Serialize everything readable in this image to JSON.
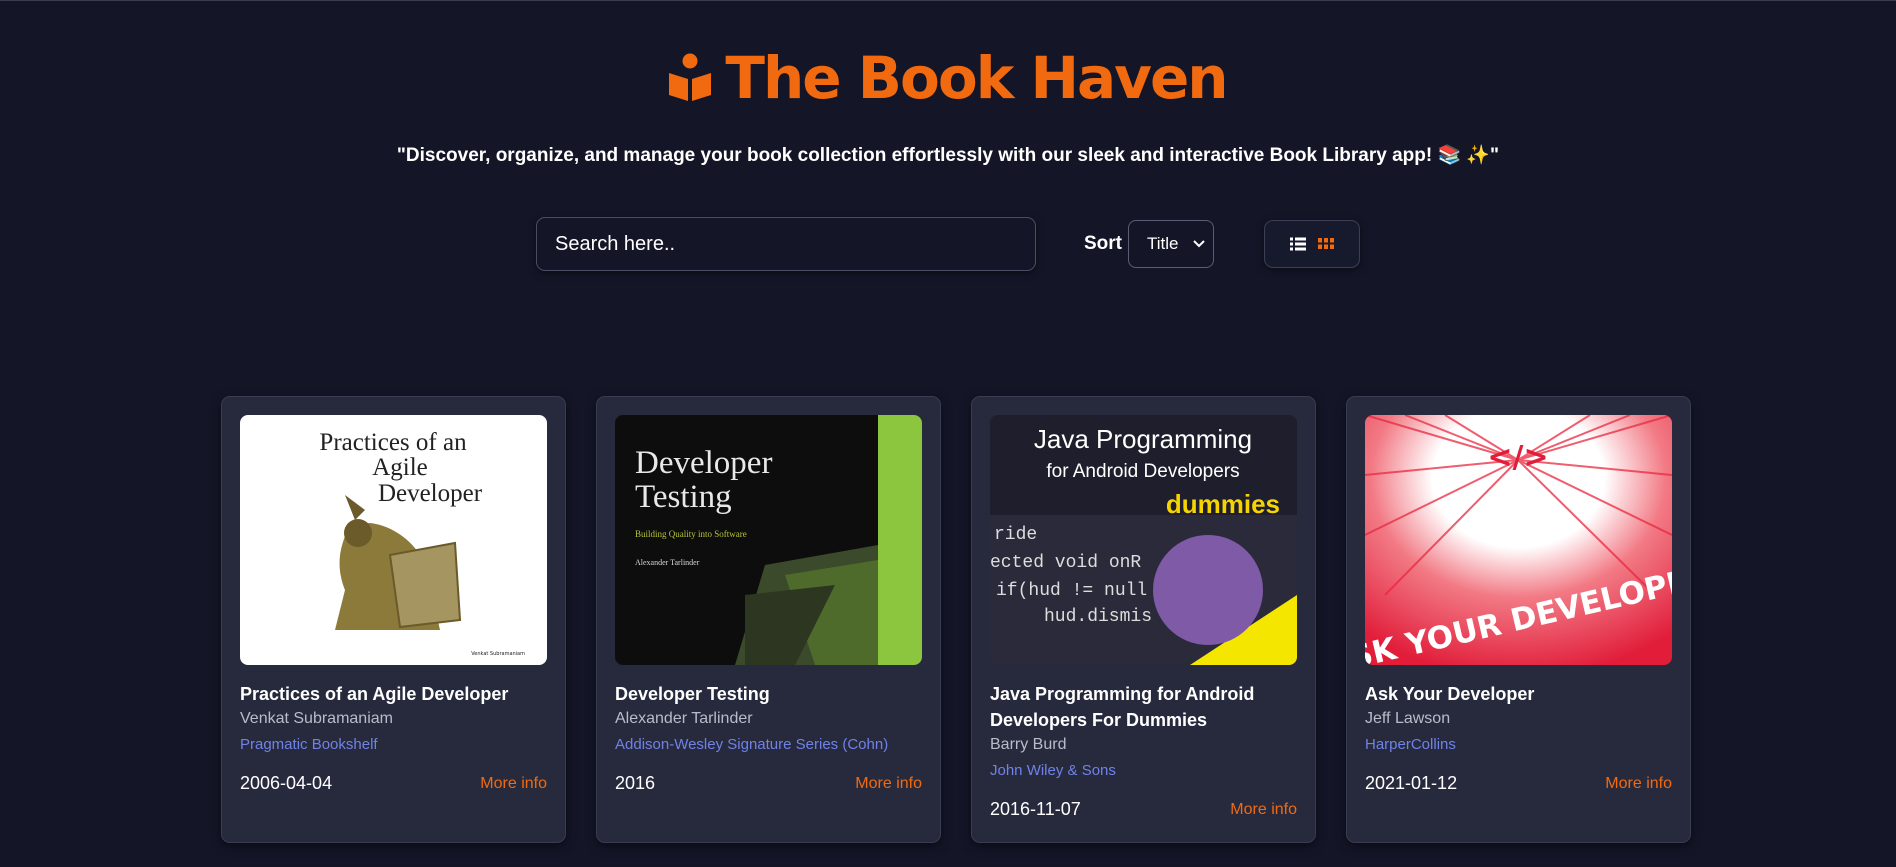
{
  "header": {
    "logo_icon": "reading-person-icon",
    "title": "The Book Haven",
    "accent_color": "#f26a0f"
  },
  "tagline": "\"Discover, organize, and manage your book collection effortlessly with our sleek and interactive Book Library app! 📚 ✨\"",
  "controls": {
    "search_placeholder": "Search here..",
    "sort_label": "Sort",
    "sort_selected": "Title",
    "view_options": [
      "list-view-icon",
      "grid-view-icon"
    ],
    "active_view": "grid"
  },
  "books": [
    {
      "title": "Practices of an Agile Developer",
      "author": "Venkat Subramaniam",
      "publisher": "Pragmatic Bookshelf",
      "date": "2006-04-04",
      "more": "More info",
      "cover": {
        "line1": "Practices of an",
        "line2": "Agile",
        "line3": "Developer",
        "footer": "Venkat Subramaniam"
      }
    },
    {
      "title": "Developer Testing",
      "author": "Alexander Tarlinder",
      "publisher": "Addison-Wesley Signature Series (Cohn)",
      "date": "2016",
      "more": "More info",
      "cover": {
        "line1": "Developer",
        "line2": "Testing",
        "subtitle": "Building Quality into Software",
        "author": "Alexander Tarlinder"
      }
    },
    {
      "title": "Java Programming for Android Developers For Dummies",
      "author": "Barry Burd",
      "publisher": "John Wiley & Sons",
      "date": "2016-11-07",
      "more": "More info",
      "cover": {
        "line1": "Java Programming",
        "line2": "for Android Developers",
        "brand": "dummies",
        "code1": "ride",
        "code2": "ected void onR",
        "code3": "if(hud != null",
        "code4": "hud.dismis"
      }
    },
    {
      "title": "Ask Your Developer",
      "author": "Jeff Lawson",
      "publisher": "HarperCollins",
      "date": "2021-01-12",
      "more": "More info",
      "cover": {
        "symbol": "</>",
        "headline": "ASK YOUR DEVELOPER"
      }
    }
  ]
}
